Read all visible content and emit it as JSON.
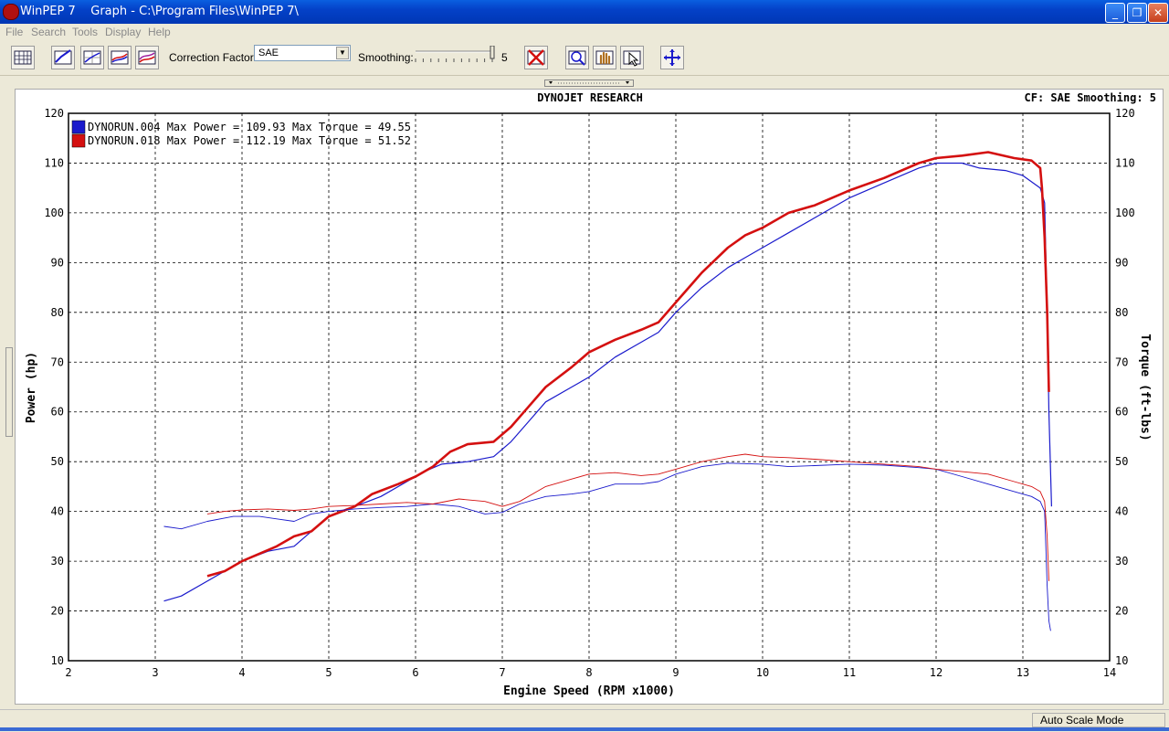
{
  "window": {
    "title": "WinPEP 7    Graph - C:\\Program Files\\WinPEP 7\\",
    "minimize": "_",
    "maximize": "❐",
    "close": "✕"
  },
  "menu": {
    "items": [
      {
        "label": "File"
      },
      {
        "label": "Search"
      },
      {
        "label": "Tools"
      },
      {
        "label": "Display"
      },
      {
        "label": "Help"
      }
    ]
  },
  "toolbar": {
    "correction_label": "Correction Factor:",
    "correction_value": "SAE",
    "smoothing_label": "Smoothing:",
    "smoothing_value": "5",
    "smoothing_level": 5,
    "icons": [
      "grid-icon",
      "power-curve-icon",
      "line-curve-icon",
      "overlay-curve-icon",
      "multi-curve-icon",
      "clear-runs-icon",
      "zoom-icon",
      "pan-hand-icon",
      "cursor-icon",
      "autoscale-icon"
    ]
  },
  "status": {
    "mode": "Auto Scale Mode"
  },
  "colors": {
    "run1": "#1a1acc",
    "run2": "#d41010"
  },
  "chart_data": {
    "type": "line",
    "title": "DYNOJET RESEARCH",
    "info": "CF: SAE  Smoothing: 5",
    "xlabel": "Engine Speed (RPM x1000)",
    "ylabel": "Power (hp)",
    "y2label": "Torque (ft-lbs)",
    "xlim": [
      2,
      14
    ],
    "ylim": [
      10,
      120
    ],
    "y2lim": [
      10,
      120
    ],
    "xticks": [
      "2",
      "3",
      "4",
      "5",
      "6",
      "7",
      "8",
      "9",
      "10",
      "11",
      "12",
      "13",
      "14"
    ],
    "yticks": [
      "10",
      "20",
      "30",
      "40",
      "50",
      "60",
      "70",
      "80",
      "90",
      "100",
      "110",
      "120"
    ],
    "grid": true,
    "legend_position": "top-left",
    "legend": [
      {
        "text": "DYNORUN.004 Max Power = 109.93 Max Torque = 49.55",
        "color": "#1a1acc"
      },
      {
        "text": "DYNORUN.018 Max Power = 112.19 Max Torque = 51.52",
        "color": "#d41010"
      }
    ],
    "series": [
      {
        "name": "DYNORUN.004",
        "kind": "power",
        "points": [
          [
            3.1,
            22
          ],
          [
            3.3,
            23
          ],
          [
            3.6,
            26
          ],
          [
            4.0,
            30
          ],
          [
            4.3,
            32
          ],
          [
            4.6,
            33
          ],
          [
            4.8,
            36
          ],
          [
            5.0,
            39
          ],
          [
            5.3,
            41
          ],
          [
            5.6,
            43
          ],
          [
            5.9,
            46
          ],
          [
            6.1,
            48
          ],
          [
            6.3,
            49.5
          ],
          [
            6.6,
            50
          ],
          [
            6.9,
            51
          ],
          [
            7.1,
            54
          ],
          [
            7.3,
            58
          ],
          [
            7.5,
            62
          ],
          [
            7.8,
            65
          ],
          [
            8.0,
            67
          ],
          [
            8.3,
            71
          ],
          [
            8.6,
            74
          ],
          [
            8.8,
            76
          ],
          [
            9.0,
            80
          ],
          [
            9.3,
            85
          ],
          [
            9.6,
            89
          ],
          [
            9.8,
            91
          ],
          [
            10.0,
            93
          ],
          [
            10.3,
            96
          ],
          [
            10.6,
            99
          ],
          [
            11.0,
            103
          ],
          [
            11.4,
            106
          ],
          [
            11.8,
            109
          ],
          [
            12.0,
            110
          ],
          [
            12.3,
            110
          ],
          [
            12.5,
            109
          ],
          [
            12.8,
            108.5
          ],
          [
            13.0,
            107.5
          ],
          [
            13.2,
            105
          ],
          [
            13.25,
            102
          ],
          [
            13.28,
            80
          ],
          [
            13.3,
            60
          ],
          [
            13.33,
            41
          ]
        ]
      },
      {
        "name": "DYNORUN.018",
        "kind": "power",
        "points": [
          [
            3.6,
            27
          ],
          [
            3.8,
            28
          ],
          [
            4.0,
            30
          ],
          [
            4.2,
            31.5
          ],
          [
            4.4,
            33
          ],
          [
            4.6,
            35
          ],
          [
            4.8,
            36
          ],
          [
            5.0,
            39
          ],
          [
            5.3,
            41
          ],
          [
            5.5,
            43.5
          ],
          [
            5.8,
            45.5
          ],
          [
            6.0,
            47
          ],
          [
            6.2,
            49
          ],
          [
            6.4,
            52
          ],
          [
            6.6,
            53.5
          ],
          [
            6.9,
            54
          ],
          [
            7.1,
            57
          ],
          [
            7.3,
            61
          ],
          [
            7.5,
            65
          ],
          [
            7.8,
            69
          ],
          [
            8.0,
            72
          ],
          [
            8.3,
            74.5
          ],
          [
            8.6,
            76.5
          ],
          [
            8.8,
            78
          ],
          [
            9.0,
            82
          ],
          [
            9.3,
            88
          ],
          [
            9.6,
            93
          ],
          [
            9.8,
            95.5
          ],
          [
            10.0,
            97
          ],
          [
            10.3,
            100
          ],
          [
            10.6,
            101.5
          ],
          [
            11.0,
            104.5
          ],
          [
            11.4,
            107
          ],
          [
            11.8,
            110
          ],
          [
            12.0,
            111
          ],
          [
            12.3,
            111.5
          ],
          [
            12.6,
            112.2
          ],
          [
            12.9,
            111
          ],
          [
            13.1,
            110.5
          ],
          [
            13.2,
            109
          ],
          [
            13.22,
            105
          ],
          [
            13.25,
            95
          ],
          [
            13.28,
            80
          ],
          [
            13.3,
            64
          ]
        ]
      },
      {
        "name": "DYNORUN.004",
        "kind": "torque",
        "points": [
          [
            3.1,
            37
          ],
          [
            3.3,
            36.5
          ],
          [
            3.6,
            38
          ],
          [
            3.9,
            39
          ],
          [
            4.2,
            39
          ],
          [
            4.4,
            38.5
          ],
          [
            4.6,
            38
          ],
          [
            4.8,
            39.5
          ],
          [
            5.0,
            40
          ],
          [
            5.3,
            40.5
          ],
          [
            5.6,
            40.8
          ],
          [
            5.9,
            41
          ],
          [
            6.2,
            41.5
          ],
          [
            6.5,
            41
          ],
          [
            6.8,
            39.5
          ],
          [
            7.0,
            39.8
          ],
          [
            7.2,
            41.5
          ],
          [
            7.5,
            43
          ],
          [
            7.8,
            43.5
          ],
          [
            8.0,
            44
          ],
          [
            8.3,
            45.5
          ],
          [
            8.6,
            45.5
          ],
          [
            8.8,
            46
          ],
          [
            9.0,
            47.5
          ],
          [
            9.3,
            49
          ],
          [
            9.6,
            49.7
          ],
          [
            10.0,
            49.5
          ],
          [
            10.3,
            49
          ],
          [
            10.6,
            49.2
          ],
          [
            11.0,
            49.5
          ],
          [
            11.4,
            49.3
          ],
          [
            11.8,
            48.8
          ],
          [
            12.0,
            48.5
          ],
          [
            12.3,
            47
          ],
          [
            12.6,
            45.5
          ],
          [
            12.9,
            44
          ],
          [
            13.1,
            43
          ],
          [
            13.2,
            42
          ],
          [
            13.25,
            40
          ],
          [
            13.28,
            25
          ],
          [
            13.3,
            18
          ],
          [
            13.32,
            16
          ]
        ]
      },
      {
        "name": "DYNORUN.018",
        "kind": "torque",
        "points": [
          [
            3.6,
            39.5
          ],
          [
            3.8,
            40
          ],
          [
            4.0,
            40.3
          ],
          [
            4.3,
            40.5
          ],
          [
            4.6,
            40.2
          ],
          [
            4.8,
            40.5
          ],
          [
            5.0,
            41
          ],
          [
            5.3,
            41.2
          ],
          [
            5.6,
            41.5
          ],
          [
            5.9,
            41.8
          ],
          [
            6.2,
            41.5
          ],
          [
            6.5,
            42.5
          ],
          [
            6.8,
            42
          ],
          [
            7.0,
            41
          ],
          [
            7.2,
            42
          ],
          [
            7.5,
            45
          ],
          [
            7.8,
            46.5
          ],
          [
            8.0,
            47.5
          ],
          [
            8.3,
            47.8
          ],
          [
            8.6,
            47.2
          ],
          [
            8.8,
            47.5
          ],
          [
            9.0,
            48.5
          ],
          [
            9.3,
            50
          ],
          [
            9.6,
            51
          ],
          [
            9.8,
            51.5
          ],
          [
            10.0,
            51
          ],
          [
            10.3,
            50.8
          ],
          [
            10.6,
            50.5
          ],
          [
            11.0,
            50
          ],
          [
            11.4,
            49.5
          ],
          [
            11.8,
            49
          ],
          [
            12.0,
            48.5
          ],
          [
            12.3,
            48
          ],
          [
            12.6,
            47.5
          ],
          [
            12.9,
            46
          ],
          [
            13.1,
            45
          ],
          [
            13.2,
            44
          ],
          [
            13.25,
            42
          ],
          [
            13.28,
            35
          ],
          [
            13.3,
            26
          ]
        ]
      }
    ]
  }
}
